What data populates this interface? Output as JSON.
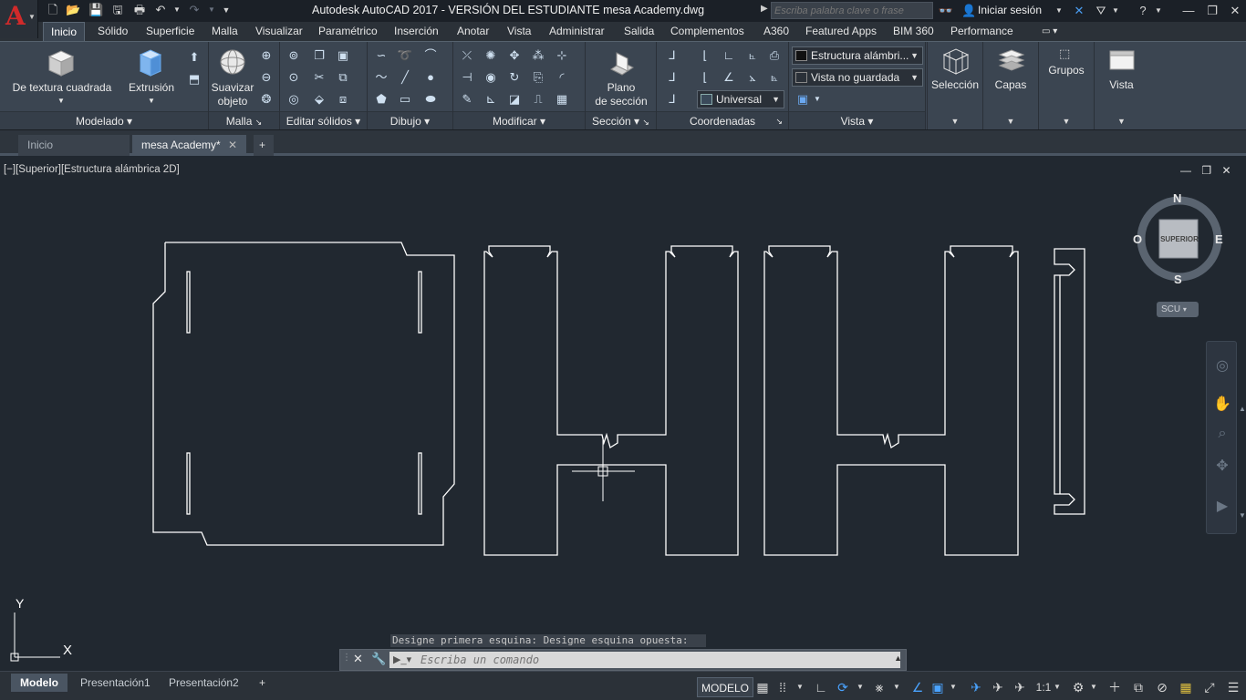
{
  "app": {
    "title": "Autodesk AutoCAD 2017 - VERSIÓN DEL ESTUDIANTE    mesa Academy.dwg",
    "logo_letter": "A",
    "search_placeholder": "Escriba palabra clave o frase",
    "signin_label": "Iniciar sesión"
  },
  "ribbon_tabs": [
    "Inicio",
    "Sólido",
    "Superficie",
    "Malla",
    "Visualizar",
    "Paramétrico",
    "Inserción",
    "Anotar",
    "Vista",
    "Administrar",
    "Salida",
    "Complementos",
    "A360",
    "Featured Apps",
    "BIM 360",
    "Performance"
  ],
  "ribbon": {
    "modelado": {
      "title": "Modelado",
      "box_label": "De textura cuadrada",
      "extrude_label": "Extrusión"
    },
    "malla": {
      "title": "Malla",
      "smooth_label_1": "Suavizar",
      "smooth_label_2": "objeto"
    },
    "editar_solidos": {
      "title": "Editar sólidos"
    },
    "dibujo": {
      "title": "Dibujo"
    },
    "modificar": {
      "title": "Modificar"
    },
    "seccion": {
      "title": "Sección",
      "plane_label_1": "Plano",
      "plane_label_2": "de sección"
    },
    "coordenadas": {
      "title": "Coordenadas",
      "ucs_value": "Universal"
    },
    "vista": {
      "title": "Vista",
      "visual_style": "Estructura alámbri...",
      "named_view": "Vista no guardada"
    },
    "seleccion_label": "Selección",
    "capas_label": "Capas",
    "grupos_label": "Grupos",
    "vista_label": "Vista"
  },
  "file_tabs": [
    {
      "label": "Inicio",
      "active": false
    },
    {
      "label": "mesa Academy*",
      "active": true
    }
  ],
  "viewport": {
    "label": "[−][Superior][Estructura alámbrica 2D]",
    "viewcube_face": "SUPERIOR",
    "compass": {
      "n": "N",
      "s": "S",
      "e": "E",
      "w": "O"
    },
    "ucs_badge": "SCU",
    "axis_x": "X",
    "axis_y": "Y"
  },
  "command": {
    "history": "Designe primera esquina: Designe esquina opuesta:",
    "placeholder": "Escriba un comando"
  },
  "layout_tabs": [
    {
      "label": "Modelo",
      "active": true
    },
    {
      "label": "Presentación1",
      "active": false
    },
    {
      "label": "Presentación2",
      "active": false
    }
  ],
  "status": {
    "model_label": "MODELO",
    "scale_label": "1:1"
  }
}
